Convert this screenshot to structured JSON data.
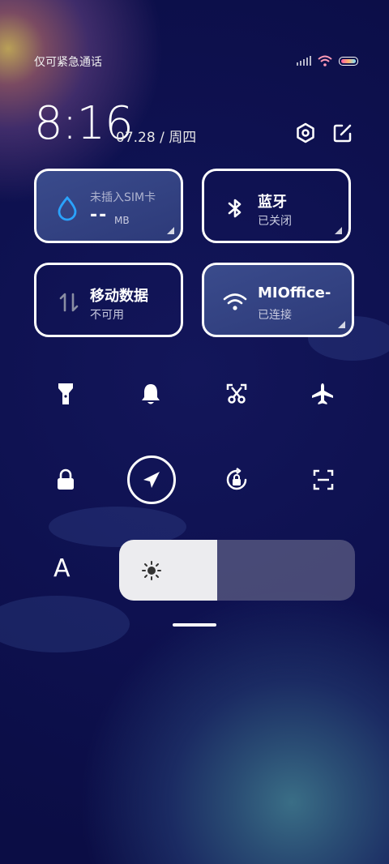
{
  "status_bar": {
    "carrier": "仅可紧急通话",
    "icons": [
      "signal-icon",
      "wifi-icon",
      "battery-icon"
    ]
  },
  "header": {
    "time": "8:16",
    "date": "07.28 / 周四",
    "icons": [
      "settings-icon",
      "edit-icon"
    ]
  },
  "tiles": {
    "data_usage": {
      "title": "未插入SIM卡",
      "value": "--",
      "unit": "MB",
      "icon": "water-drop-icon"
    },
    "bluetooth": {
      "title": "蓝牙",
      "status": "已关闭",
      "icon": "bluetooth-icon"
    },
    "mobile_data": {
      "title": "移动数据",
      "status": "不可用",
      "icon": "mobile-data-icon"
    },
    "wifi": {
      "title": "MIOffice-",
      "status": "已连接",
      "icon": "wifi-icon"
    }
  },
  "quick_toggles": {
    "row1": [
      "flashlight-icon",
      "bell-icon",
      "screenshot-icon",
      "airplane-icon"
    ],
    "row2": [
      "lock-icon",
      "location-icon",
      "rotation-lock-icon",
      "scan-icon"
    ]
  },
  "brightness": {
    "auto_label": "A",
    "level": 0.415
  },
  "colors": {
    "background": "#0d1049",
    "tile_active": "#34438a",
    "accent_blue": "#2aa3ff",
    "slider_fill": "#ececef"
  }
}
